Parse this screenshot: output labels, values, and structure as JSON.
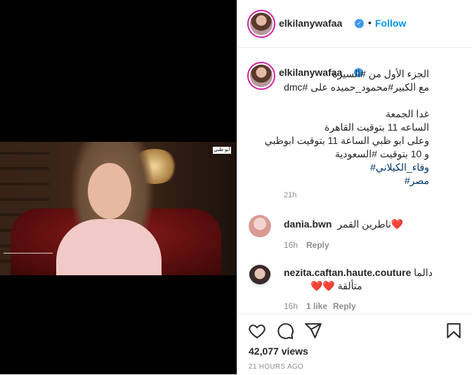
{
  "post": {
    "username": "elkilanywafaa",
    "follow_label": "Follow",
    "separator": "•",
    "caption_username": "elkilanywafaa",
    "caption_lines": [
      "الجزء الأول من #السيرة",
      "مع الكبير#محمود_حميده على #dmc",
      "",
      "غدا الجمعة",
      "الساعه 11 بتوقيت القاهرة",
      "وعلى ابو ظبي الساعة 11 بتوقيت ابوظبي",
      "و 10 بتوقيت #السعودية",
      "وفاء_الكيلاني#",
      "مصر#"
    ],
    "caption_time": "21h",
    "video_logo": "أبو ظبي"
  },
  "comments": [
    {
      "username": "dania.bwn",
      "text": "ناطرين القمر ",
      "heart": "❤️",
      "time": "16h",
      "likes": "",
      "reply_label": "Reply"
    },
    {
      "username": "nezita.caftan.haute.couture",
      "text": "دالما",
      "text2": "متألقة ",
      "heart": "❤️❤️",
      "time": "16h",
      "likes": "1 like",
      "reply_label": "Reply"
    }
  ],
  "actions": {
    "views": "42,077 views",
    "ago": "21 HOURS AGO"
  },
  "icons": [
    "verified-icon",
    "heart-icon",
    "comment-icon",
    "share-icon",
    "bookmark-icon"
  ],
  "colors": {
    "link": "#0095f6",
    "verified": "#3897f0",
    "muted": "#8e8e8e",
    "hashtag": "#00376b"
  }
}
